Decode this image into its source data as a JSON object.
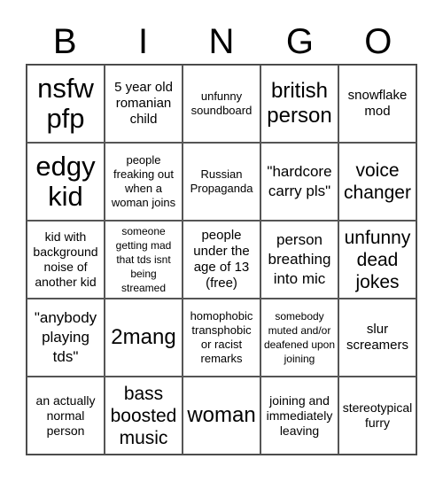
{
  "header": [
    "B",
    "I",
    "N",
    "G",
    "O"
  ],
  "cells": [
    {
      "text": "nsfw pfp",
      "size": "xl"
    },
    {
      "text": "5 year old romanian child",
      "size": "m2"
    },
    {
      "text": "unfunny soundboard",
      "size": "xs"
    },
    {
      "text": "british person",
      "size": "l"
    },
    {
      "text": "snowflake mod",
      "size": "m2"
    },
    {
      "text": "edgy kid",
      "size": "xl"
    },
    {
      "text": "people freaking out when a woman joins",
      "size": "xs"
    },
    {
      "text": "Russian Propaganda",
      "size": "xs"
    },
    {
      "text": "\"hardcore carry pls\"",
      "size": "m"
    },
    {
      "text": "voice changer",
      "size": "ml"
    },
    {
      "text": "kid with background noise of another kid",
      "size": "s"
    },
    {
      "text": "someone getting mad that tds isnt being streamed",
      "size": "xxs"
    },
    {
      "text": "people under the age of 13 (free)",
      "size": "m2"
    },
    {
      "text": "person breathing into mic",
      "size": "m"
    },
    {
      "text": "unfunny dead jokes",
      "size": "ml"
    },
    {
      "text": "\"anybody playing tds\"",
      "size": "m"
    },
    {
      "text": "2mang",
      "size": "l"
    },
    {
      "text": "homophobic transphobic or racist remarks",
      "size": "xs"
    },
    {
      "text": "somebody muted and/or deafened upon joining",
      "size": "xxs"
    },
    {
      "text": "slur screamers",
      "size": "m2"
    },
    {
      "text": "an actually normal person",
      "size": "s"
    },
    {
      "text": "bass boosted music",
      "size": "ml"
    },
    {
      "text": "woman",
      "size": "l"
    },
    {
      "text": "joining and immediately leaving",
      "size": "s"
    },
    {
      "text": "stereotypical furry",
      "size": "s"
    }
  ]
}
